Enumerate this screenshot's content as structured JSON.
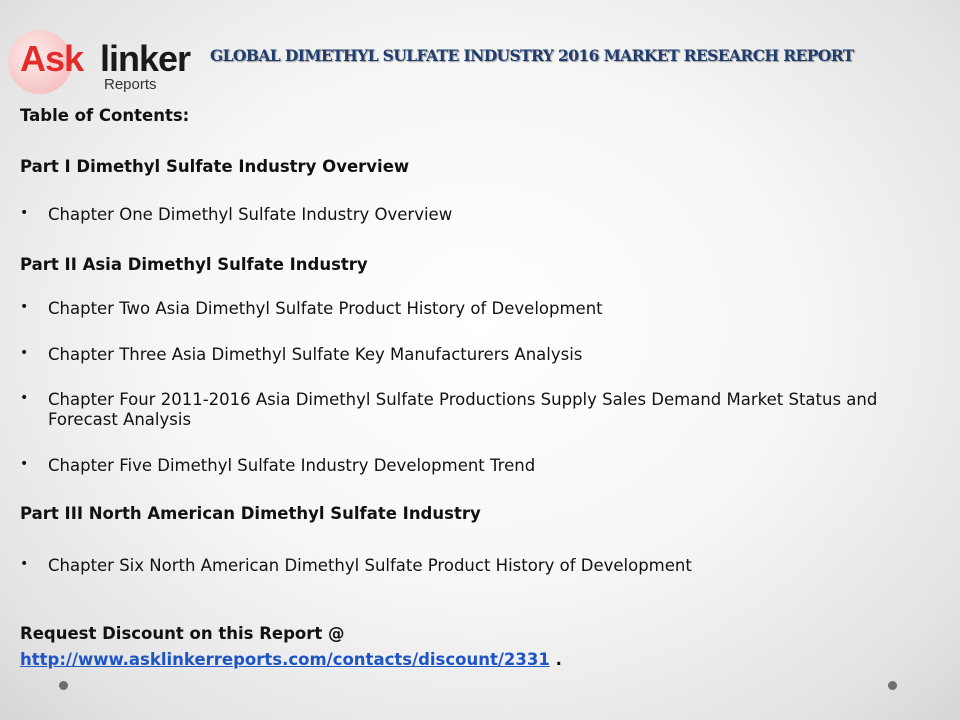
{
  "logo": {
    "ask": "Ask",
    "linker": "linker",
    "reports": "Reports"
  },
  "title": "GLOBAL DIMETHYL SULFATE INDUSTRY 2016 MARKET RESEARCH REPORT",
  "toc_heading": "Table of Contents:",
  "part1": {
    "heading": "Part I Dimethyl Sulfate Industry Overview",
    "items": [
      "Chapter One Dimethyl Sulfate Industry Overview"
    ]
  },
  "part2": {
    "heading": "Part II Asia Dimethyl Sulfate Industry",
    "items": [
      "Chapter Two Asia Dimethyl Sulfate Product History of Development",
      "Chapter Three Asia Dimethyl Sulfate Key Manufacturers Analysis",
      "Chapter Four 2011-2016 Asia Dimethyl Sulfate Productions Supply Sales Demand Market Status and Forecast Analysis",
      "Chapter Five Dimethyl Sulfate Industry Development Trend"
    ]
  },
  "part3": {
    "heading": "Part III North American Dimethyl Sulfate Industry",
    "items": [
      "Chapter Six North American Dimethyl Sulfate Product History of Development"
    ]
  },
  "request": {
    "text": "Request Discount on this Report @",
    "url": "http://www.asklinkerreports.com/contacts/discount/2331",
    "suffix": " ."
  },
  "bullet_glyph": "•",
  "colors": {
    "title": "#1f3d6e",
    "logo_red": "#e32b2b",
    "link": "#1d54c6"
  }
}
